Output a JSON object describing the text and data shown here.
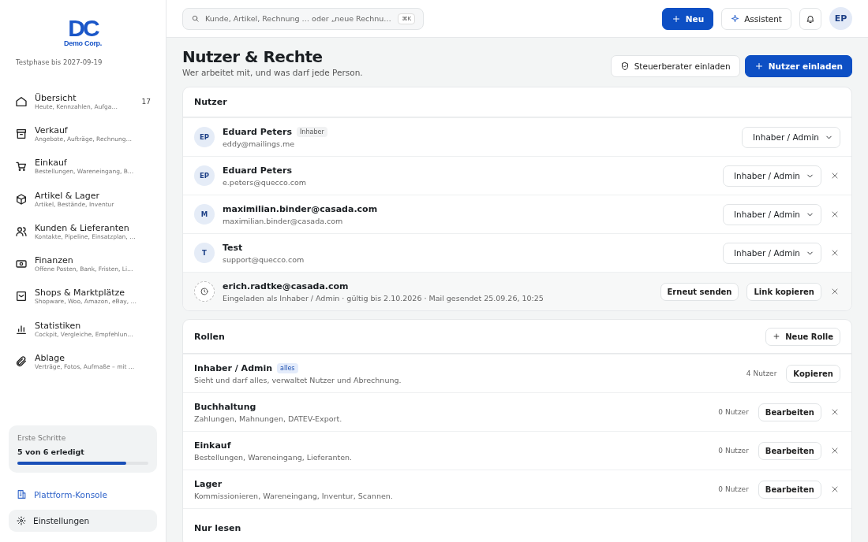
{
  "brand": {
    "logo": "DC",
    "name": "Demo Corp.",
    "trial": "Testphase bis 2027-09-19"
  },
  "nav": [
    {
      "title": "Übersicht",
      "subtitle": "Heute, Kennzahlen, Aufga…",
      "badge": "17"
    },
    {
      "title": "Verkauf",
      "subtitle": "Angebote, Aufträge, Rechnung…"
    },
    {
      "title": "Einkauf",
      "subtitle": "Bestellungen, Wareneingang, B…"
    },
    {
      "title": "Artikel & Lager",
      "subtitle": "Artikel, Bestände, Inventur"
    },
    {
      "title": "Kunden & Lieferanten",
      "subtitle": "Kontakte, Pipeline, Einsatzplan, …"
    },
    {
      "title": "Finanzen",
      "subtitle": "Offene Posten, Bank, Fristen, Li…"
    },
    {
      "title": "Shops & Marktplätze",
      "subtitle": "Shopware, Woo, Amazon, eBay, …"
    },
    {
      "title": "Statistiken",
      "subtitle": "Cockpit, Vergleiche, Empfehlun…"
    },
    {
      "title": "Ablage",
      "subtitle": "Verträge, Fotos, Aufmaße – mit …"
    }
  ],
  "onboarding": {
    "title": "Erste Schritte",
    "status": "5 von 6 erledigt",
    "level": 0.83
  },
  "platform_link": "Plattform-Konsole",
  "settings": "Einstellungen",
  "search": {
    "placeholder": "Kunde, Artikel, Rechnung … oder „neue Rechnu…",
    "shortcut": "⌘K"
  },
  "top_actions": {
    "new": "Neu",
    "assistant": "Assistent",
    "avatar": "EP"
  },
  "page": {
    "title": "Nutzer & Rechte",
    "subtitle": "Wer arbeitet mit, und was darf jede Person.",
    "secondary": "Steuerberater einladen",
    "primary": "Nutzer einladen"
  },
  "users": {
    "title": "Nutzer",
    "rows": [
      {
        "kind": "member",
        "initials": "EP",
        "name": "Eduard Peters",
        "tag": "Inhaber",
        "email": "eddy@mailings.me",
        "role": "Inhaber / Admin",
        "removable": false
      },
      {
        "kind": "member",
        "initials": "EP",
        "name": "Eduard Peters",
        "email": "e.peters@quecco.com",
        "role": "Inhaber / Admin",
        "removable": true
      },
      {
        "kind": "member",
        "initials": "M",
        "name": "maximilian.binder@casada.com",
        "email": "maximilian.binder@casada.com",
        "role": "Inhaber / Admin",
        "removable": true
      },
      {
        "kind": "member",
        "initials": "T",
        "name": "Test",
        "email": "support@quecco.com",
        "role": "Inhaber / Admin",
        "removable": true
      },
      {
        "kind": "invite",
        "name": "erich.radtke@casada.com",
        "email": "Eingeladen als Inhaber / Admin · gültig bis 2.10.2026 · Mail gesendet 25.09.26, 10:25",
        "actions": [
          "Erneut senden",
          "Link kopieren"
        ],
        "removable": true
      }
    ]
  },
  "roles": {
    "title": "Rollen",
    "new": "Neue Rolle",
    "rows": [
      {
        "name": "Inhaber / Admin",
        "tag": "alles",
        "description": "Sieht und darf alles, verwaltet Nutzer und Abrechnung.",
        "count": "4 Nutzer",
        "action": "Kopieren",
        "removable": false
      },
      {
        "name": "Buchhaltung",
        "description": "Zahlungen, Mahnungen, DATEV-Export.",
        "count": "0 Nutzer",
        "action": "Bearbeiten",
        "removable": true
      },
      {
        "name": "Einkauf",
        "description": "Bestellungen, Wareneingang, Lieferanten.",
        "count": "0 Nutzer",
        "action": "Bearbeiten",
        "removable": true
      },
      {
        "name": "Lager",
        "description": "Kommissionieren, Wareneingang, Inventur, Scannen.",
        "count": "0 Nutzer",
        "action": "Bearbeiten",
        "removable": true
      },
      {
        "name": "Nur lesen"
      }
    ]
  }
}
